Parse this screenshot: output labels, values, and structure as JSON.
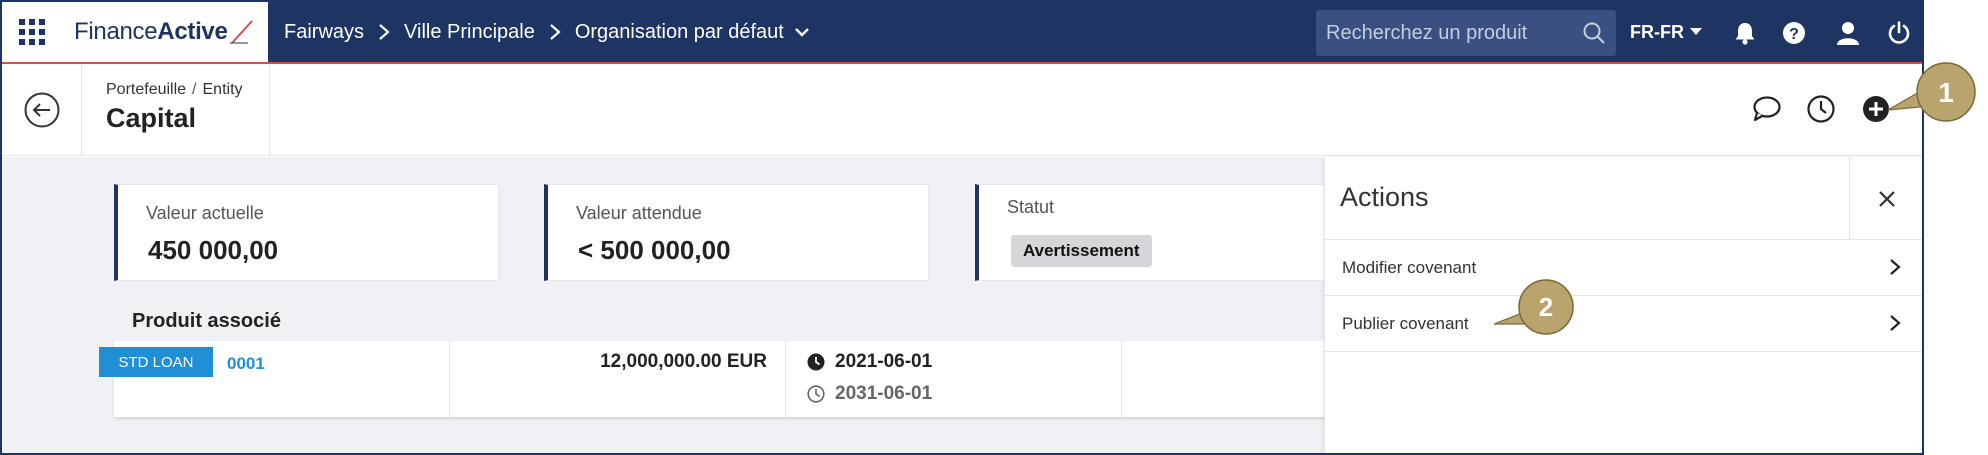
{
  "header": {
    "logo": {
      "part1": "Finance",
      "part2": "Active"
    },
    "breadcrumb": [
      "Fairways",
      "Ville Principale",
      "Organisation par défaut"
    ],
    "search": {
      "placeholder": "Recherchez un produit"
    },
    "language": "FR-FR"
  },
  "page": {
    "breadcrumb": [
      "Portefeuille",
      "Entity"
    ],
    "title": "Capital"
  },
  "cards": {
    "current": {
      "label": "Valeur actuelle",
      "value": "450 000,00"
    },
    "expected": {
      "label": "Valeur attendue",
      "value": "< 500 000,00"
    },
    "status": {
      "label": "Statut",
      "badge": "Avertissement"
    }
  },
  "product": {
    "section_title": "Produit associé",
    "type_badge": "STD LOAN",
    "id": "0001",
    "amount": "12,000,000.00 EUR",
    "start_date": "2021-06-01",
    "end_date": "2031-06-01"
  },
  "actions_panel": {
    "title": "Actions",
    "items": [
      "Modifier covenant",
      "Publier covenant"
    ]
  },
  "callouts": [
    "1",
    "2"
  ],
  "colors": {
    "navy": "#1e3462",
    "accent_red": "#d94a4a",
    "link_blue": "#1f8fd6",
    "callout_gold": "#b8a46c"
  }
}
